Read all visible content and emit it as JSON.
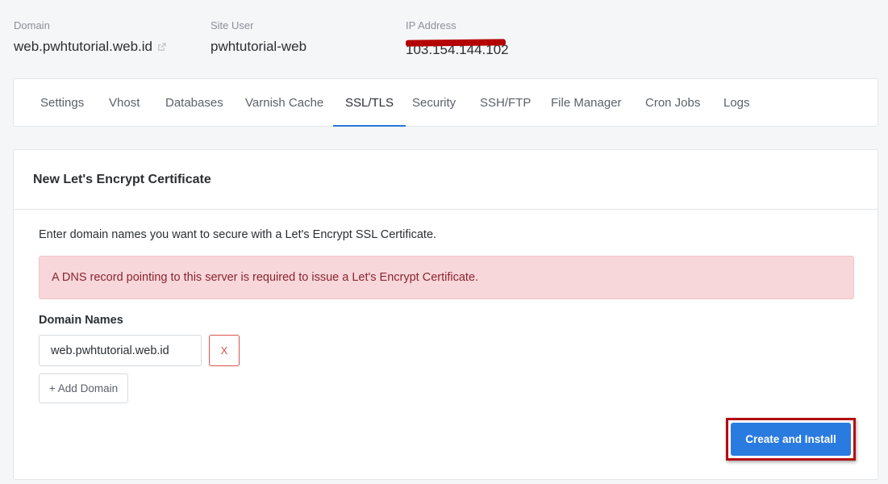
{
  "header": {
    "domain_label": "Domain",
    "domain_value": "web.pwhtutorial.web.id",
    "site_user_label": "Site User",
    "site_user_value": "pwhtutorial-web",
    "ip_label": "IP Address",
    "ip_value": "103.154.144.102",
    "ip_redacted": true,
    "redaction_color": "#b50000"
  },
  "tabs": [
    {
      "label": "Settings",
      "active": false
    },
    {
      "label": "Vhost",
      "active": false
    },
    {
      "label": "Databases",
      "active": false
    },
    {
      "label": "Varnish Cache",
      "active": false
    },
    {
      "label": "SSL/TLS",
      "active": true
    },
    {
      "label": "Security",
      "active": false
    },
    {
      "label": "SSH/FTP",
      "active": false
    },
    {
      "label": "File Manager",
      "active": false
    },
    {
      "label": "Cron Jobs",
      "active": false
    },
    {
      "label": "Logs",
      "active": false
    }
  ],
  "card": {
    "title": "New Let's Encrypt Certificate",
    "intro": "Enter domain names you want to secure with a Let's Encrypt SSL Certificate.",
    "alert": "A DNS record pointing to this server is required to issue a Let's Encrypt Certificate.",
    "domain_names_label": "Domain Names",
    "domain_input_value": "web.pwhtutorial.web.id",
    "remove_label": "X",
    "add_domain_label": "+ Add Domain",
    "create_label": "Create and Install"
  },
  "colors": {
    "accent": "#2a7be0",
    "alert_bg": "#f8d7da",
    "alert_text": "#8a2430",
    "danger": "#d9534f",
    "highlight_box": "#b50d0d"
  }
}
